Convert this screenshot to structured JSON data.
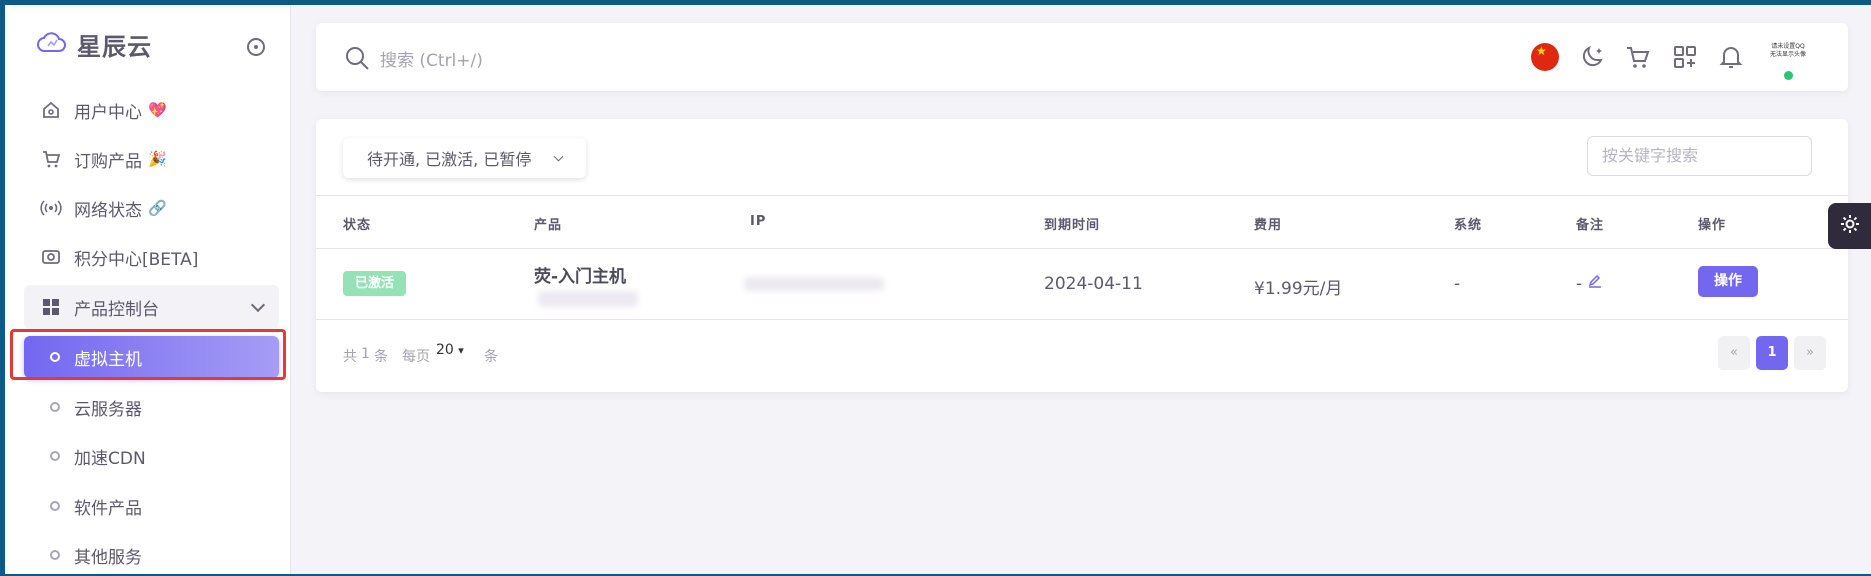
{
  "brand": {
    "name": "星辰云"
  },
  "sidebar": {
    "items": [
      {
        "label": "用户中心",
        "emoji": "💖"
      },
      {
        "label": "订购产品",
        "emoji": "🎉"
      },
      {
        "label": "网络状态",
        "emoji": "🔗"
      },
      {
        "label": "积分中心[BETA]"
      },
      {
        "label": "产品控制台"
      }
    ],
    "sub_items": [
      {
        "label": "虚拟主机",
        "active": true
      },
      {
        "label": "云服务器"
      },
      {
        "label": "加速CDN"
      },
      {
        "label": "软件产品"
      },
      {
        "label": "其他服务"
      }
    ]
  },
  "search": {
    "placeholder": "搜索 (Ctrl+/)"
  },
  "topbar": {
    "icons": [
      "china-flag-icon",
      "moon-icon",
      "cart-icon",
      "apps-add-icon",
      "bell-icon"
    ],
    "avatar_text_line1": "请未设置QQ",
    "avatar_text_line2": "无法显示头像"
  },
  "filter": {
    "selected": "待开通, 已激活, 已暂停"
  },
  "keyword_search": {
    "placeholder": "按关键字搜索"
  },
  "table": {
    "headers": [
      "状态",
      "产品",
      "IP",
      "到期时间",
      "费用",
      "系统",
      "备注",
      "操作"
    ],
    "rows": [
      {
        "status": "已激活",
        "product": "荧-入门主机",
        "expiry": "2024-04-11",
        "fee": "¥1.99元/月",
        "system": "-",
        "note": "-",
        "action": "操作"
      }
    ]
  },
  "pagination": {
    "total_prefix": "共",
    "total_count": "1",
    "total_suffix": "条",
    "per_page_label": "每页",
    "per_page_value": "20",
    "per_page_suffix": "条",
    "prev": "«",
    "current": "1",
    "next": "»"
  },
  "colors": {
    "accent": "#7367f0",
    "success": "#95e2b7",
    "highlight": "#e53935"
  }
}
